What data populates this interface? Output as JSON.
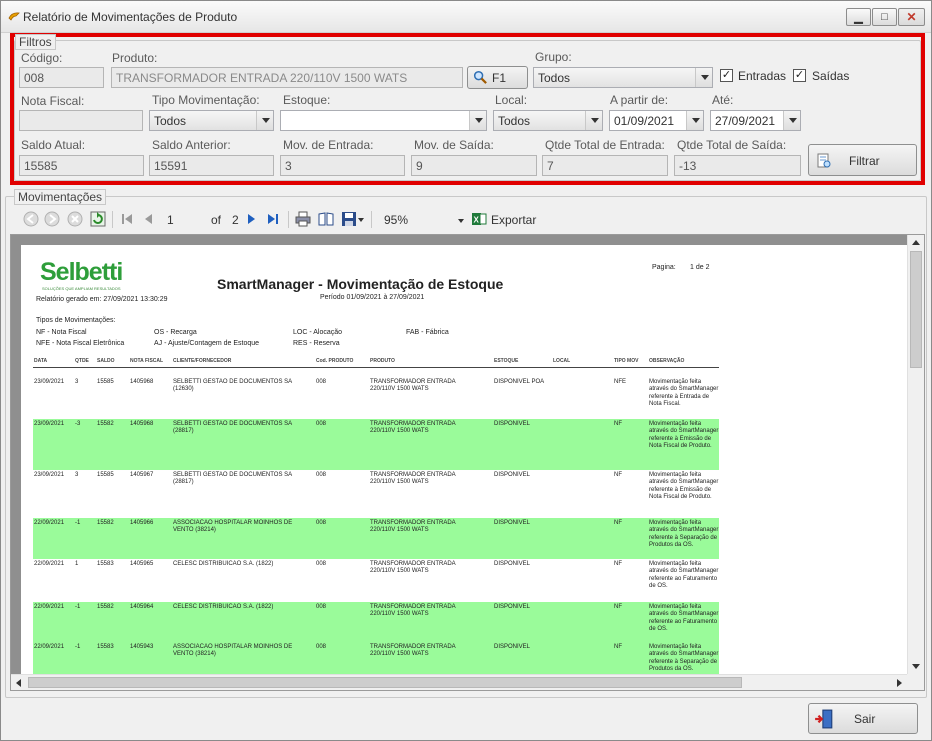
{
  "window": {
    "title": "Relatório de Movimentações de Produto"
  },
  "filtros": {
    "legend": "Filtros",
    "codigo": {
      "label": "Código:",
      "value": "008"
    },
    "produto": {
      "label": "Produto:",
      "value": "TRANSFORMADOR ENTRADA 220/110V 1500 WATS"
    },
    "f1_label": "F1",
    "grupo": {
      "label": "Grupo:",
      "value": "Todos"
    },
    "entradas": {
      "label": "Entradas",
      "checked": "✓"
    },
    "saidas": {
      "label": "Saídas",
      "checked": "✓"
    },
    "nota_fiscal": {
      "label": "Nota Fiscal:",
      "value": ""
    },
    "tipo_movimentacao": {
      "label": "Tipo Movimentação:",
      "value": "Todos"
    },
    "estoque": {
      "label": "Estoque:",
      "value": ""
    },
    "local": {
      "label": "Local:",
      "value": "Todos"
    },
    "a_partir_de": {
      "label": "A partir de:",
      "value": "01/09/2021"
    },
    "ate": {
      "label": "Até:",
      "value": "27/09/2021"
    },
    "saldo_atual": {
      "label": "Saldo Atual:",
      "value": "15585"
    },
    "saldo_anterior": {
      "label": "Saldo Anterior:",
      "value": "15591"
    },
    "mov_entrada": {
      "label": "Mov. de Entrada:",
      "value": "3"
    },
    "mov_saida": {
      "label": "Mov. de Saída:",
      "value": "9"
    },
    "qtde_total_entrada": {
      "label": "Qtde Total de Entrada:",
      "value": "7"
    },
    "qtde_total_saida": {
      "label": "Qtde Total de Saída:",
      "value": "-13"
    },
    "filtrar_label": "Filtrar"
  },
  "movimentacoes": {
    "legend": "Movimentações",
    "toolbar": {
      "page": "1",
      "of_label": "of",
      "total_pages": "2",
      "zoom": "95%",
      "export_label": "Exportar"
    }
  },
  "report": {
    "logo": "Selbetti",
    "logo_tagline": "SOLUÇÕES QUE AMPLIAM RESULTADOS",
    "title": "SmartManager - Movimentação de Estoque",
    "period": "Período 01/09/2021 à 27/09/2021",
    "generated": "Relatório gerado em:   27/09/2021 13:30:29",
    "pagina_label": "Pagina:",
    "pagina_value": "1 de 2",
    "tipos_title": "Tipos de Movimentações:",
    "tipos": [
      "NF - Nota Fiscal",
      "OS - Recarga",
      "LOC - Alocação",
      "FAB - Fábrica",
      "NFE - Nota Fiscal Eletrônica",
      "AJ - Ajuste/Contagem de Estoque",
      "RES - Reserva"
    ],
    "columns": [
      "DATA",
      "QTDE",
      "SALDO",
      "NOTA FISCAL",
      "CLIENTE/FORNECEDOR",
      "Cod. PRODUTO",
      "PRODUTO",
      "ESTOQUE",
      "LOCAL",
      "TIPO MOV",
      "OBSERVAÇÃO"
    ],
    "rows": [
      {
        "data": "23/09/2021",
        "qtde": "3",
        "saldo": "15585",
        "nf": "1405968",
        "cliente": "SELBETTI GESTAO DE DOCUMENTOS SA (12630)",
        "cod": "008",
        "produto": "TRANSFORMADOR ENTRADA 220/110V 1500 WATS",
        "estoque": "DISPONIVEL POA",
        "local": "",
        "tipo": "NFE",
        "obs": "Movimentação feita através do SmartManager referente à Entrada de Nota Fiscal."
      },
      {
        "data": "23/09/2021",
        "qtde": "-3",
        "saldo": "15582",
        "nf": "1405968",
        "cliente": "SELBETTI GESTAO DE DOCUMENTOS SA (28817)",
        "cod": "008",
        "produto": "TRANSFORMADOR ENTRADA 220/110V 1500 WATS",
        "estoque": "DISPONIVEL",
        "local": "",
        "tipo": "NF",
        "obs": "Movimentação feita através do SmartManager referente à Emissão de Nota Fiscal de Produto."
      },
      {
        "data": "23/09/2021",
        "qtde": "3",
        "saldo": "15585",
        "nf": "1405967",
        "cliente": "SELBETTI GESTAO DE DOCUMENTOS SA (28817)",
        "cod": "008",
        "produto": "TRANSFORMADOR ENTRADA 220/110V 1500 WATS",
        "estoque": "DISPONIVEL",
        "local": "",
        "tipo": "NF",
        "obs": "Movimentação feita através do SmartManager referente à Emissão de Nota Fiscal de Produto."
      },
      {
        "data": "22/09/2021",
        "qtde": "-1",
        "saldo": "15582",
        "nf": "1405966",
        "cliente": "ASSOCIACAO HOSPITALAR MOINHOS DE VENTO (38214)",
        "cod": "008",
        "produto": "TRANSFORMADOR ENTRADA 220/110V 1500 WATS",
        "estoque": "DISPONIVEL",
        "local": "",
        "tipo": "NF",
        "obs": "Movimentação feita através do SmartManager referente à Separação de Produtos da OS."
      },
      {
        "data": "22/09/2021",
        "qtde": "1",
        "saldo": "15583",
        "nf": "1405965",
        "cliente": "CELESC DISTRIBUICAO S.A. (1822)",
        "cod": "008",
        "produto": "TRANSFORMADOR ENTRADA 220/110V 1500 WATS",
        "estoque": "DISPONIVEL",
        "local": "",
        "tipo": "NF",
        "obs": "Movimentação feita através do SmartManager referente ao Faturamento de OS."
      },
      {
        "data": "22/09/2021",
        "qtde": "-1",
        "saldo": "15582",
        "nf": "1405964",
        "cliente": "CELESC DISTRIBUICAO S.A. (1822)",
        "cod": "008",
        "produto": "TRANSFORMADOR ENTRADA 220/110V 1500 WATS",
        "estoque": "DISPONIVEL",
        "local": "",
        "tipo": "NF",
        "obs": "Movimentação feita através do SmartManager referente ao Faturamento de OS."
      },
      {
        "data": "22/09/2021",
        "qtde": "-1",
        "saldo": "15583",
        "nf": "1405943",
        "cliente": "ASSOCIACAO HOSPITALAR MOINHOS DE VENTO (38214)",
        "cod": "008",
        "produto": "TRANSFORMADOR ENTRADA 220/110V 1500 WATS",
        "estoque": "DISPONIVEL",
        "local": "",
        "tipo": "NF",
        "obs": "Movimentação feita através do SmartManager referente à Separação de Produtos da OS."
      }
    ]
  },
  "footer": {
    "sair_label": "Sair"
  }
}
